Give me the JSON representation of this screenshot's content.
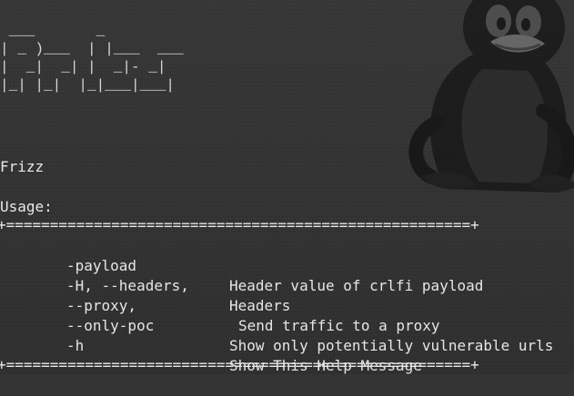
{
  "banner": {
    "ascii_art": " ___       _\n| _ )___  | |___  ___\n|  _|  _| |  _|- _|\n|_| |_|  |_|___|___|"
  },
  "tool": {
    "name": "Frizz"
  },
  "usage": {
    "label": "Usage:",
    "border": "+=====================================================+",
    "options": [
      {
        "flag": "-payload",
        "description": "Header value of crlfi payload"
      },
      {
        "flag": "-H, --headers,",
        "description": "Headers"
      },
      {
        "flag": "--proxy,",
        "description": "Send traffic to a proxy"
      },
      {
        "flag": "--only-poc",
        "description": "Show only potentially vulnerable urls"
      },
      {
        "flag": "-h",
        "description": "Show This Help Message"
      }
    ]
  },
  "colors": {
    "background": "#343434",
    "text": "#e6e6e6"
  },
  "wallpaper": {
    "icon": "tux-penguin-icon"
  }
}
